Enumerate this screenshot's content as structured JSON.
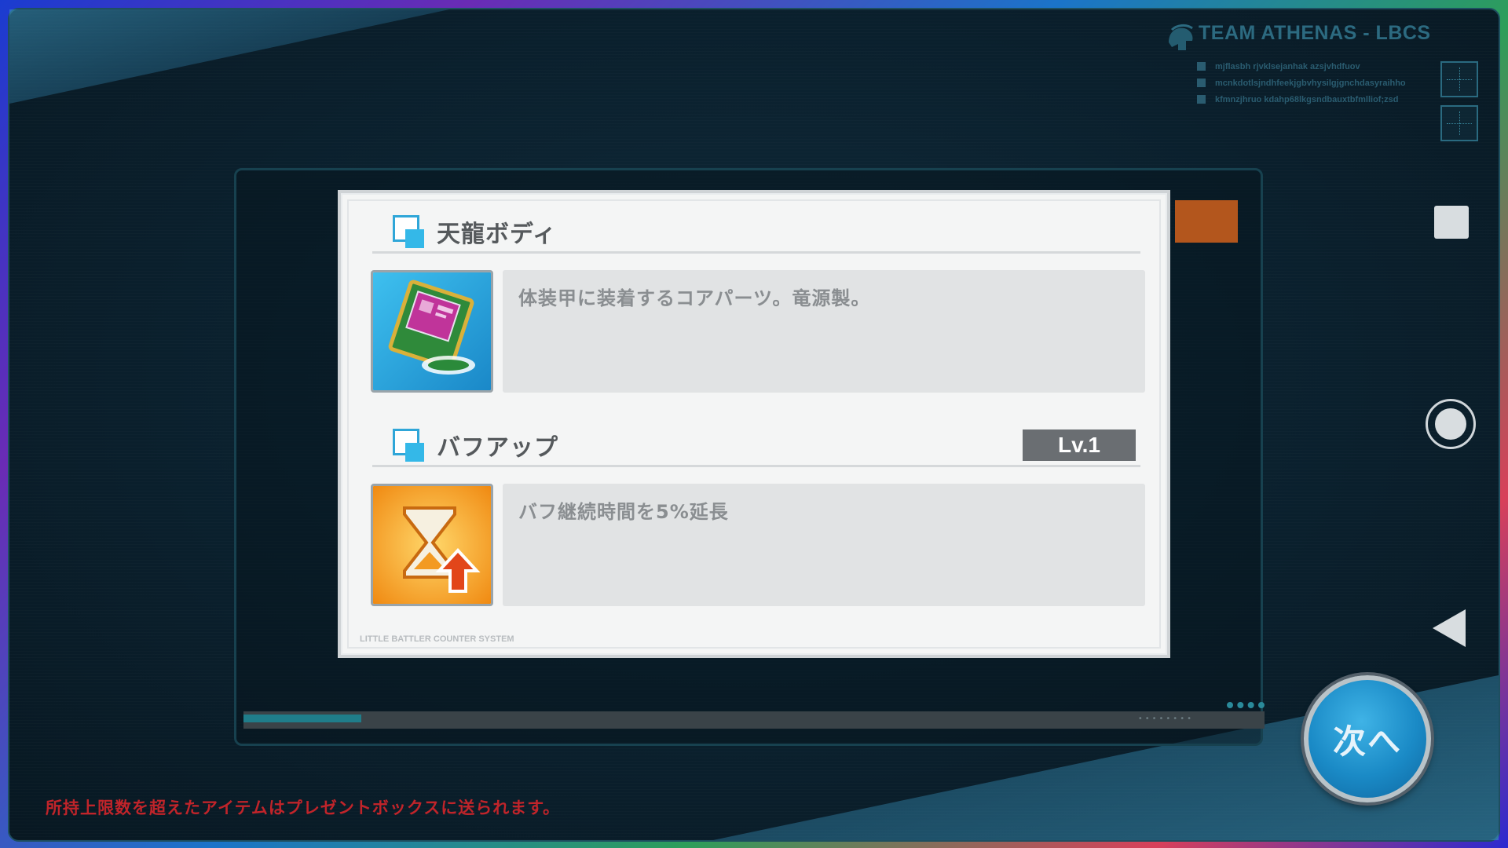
{
  "header": {
    "team_title": "TEAM ATHENAS - LBCS",
    "lines": [
      "mjflasbh rjvklsejanhak  azsjvhdfuov",
      "mcnkdotlsjndhfeekjgbvhysilgjgnchdasyraihho",
      "kfmnzjhruo  kdahp68lkgsndbauxtbfmlliof;zsd"
    ]
  },
  "dialog": {
    "sections": [
      {
        "title": "天龍ボディ",
        "icon": "core-part-chip-icon",
        "description": "体装甲に装着するコアパーツ。竜源製。"
      },
      {
        "title": "バフアップ",
        "level": "Lv.1",
        "icon": "hourglass-up-icon",
        "description": "バフ継続時間を5%延長"
      }
    ],
    "footer": "LITTLE BATTLER COUNTER SYSTEM"
  },
  "next_button": "次へ",
  "notice": "所持上限数を超えたアイテムはプレゼントボックスに送られます。",
  "colors": {
    "accent_blue": "#34b8e8",
    "notice_red": "#c0242a",
    "level_badge": "#6a6e72",
    "orange_tab": "#b3561d"
  }
}
